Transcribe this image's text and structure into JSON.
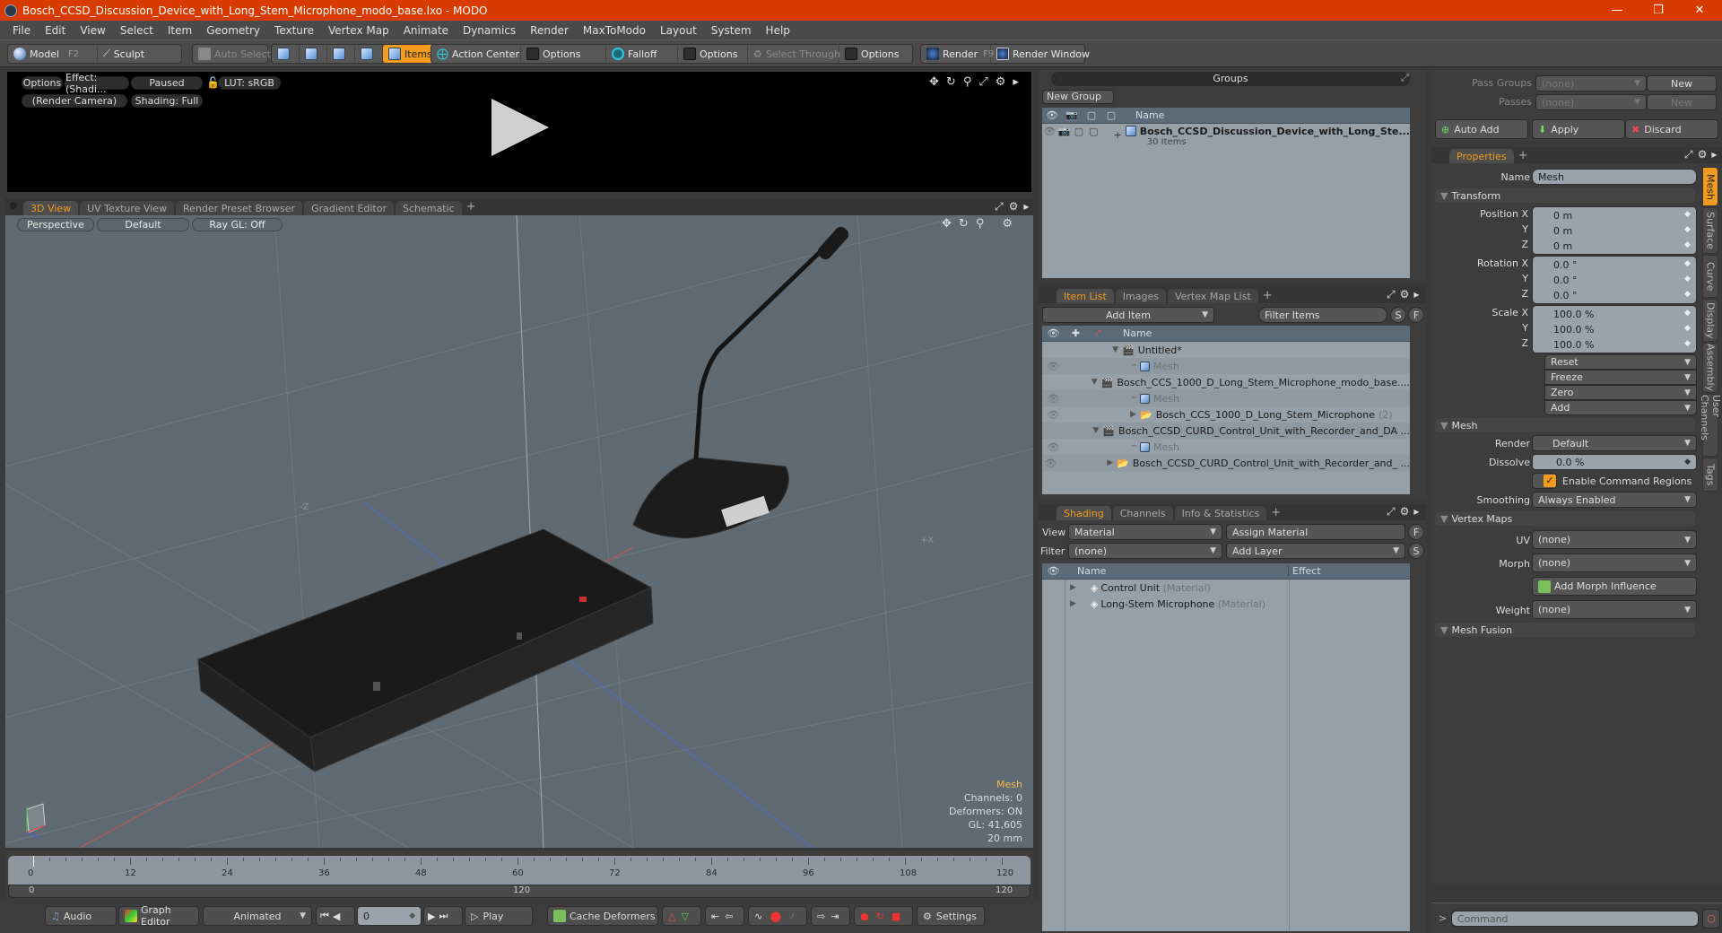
{
  "window": {
    "title": "Bosch_CCSD_Discussion_Device_with_Long_Stem_Microphone_modo_base.lxo - MODO",
    "minimize_icon": "minimize-icon",
    "restore_icon": "restore-icon",
    "close_icon": "close-icon"
  },
  "menu": [
    "File",
    "Edit",
    "View",
    "Select",
    "Item",
    "Geometry",
    "Texture",
    "Vertex Map",
    "Animate",
    "Dynamics",
    "Render",
    "MaxToModo",
    "Layout",
    "System",
    "Help"
  ],
  "toolbar": {
    "model": "Model",
    "model_key": "F2",
    "sculpt": "Sculpt",
    "auto_select": "Auto Select",
    "items": "Items",
    "items_count": "5",
    "action_center": "Action Center",
    "options1": "Options",
    "falloff": "Falloff",
    "options2": "Options",
    "select_through": "Select Through",
    "options3": "Options",
    "render": "Render",
    "render_key": "F9",
    "render_window": "Render Window"
  },
  "render_view": {
    "options": "Options",
    "effect": "Effect: (Shadi...",
    "paused": "Paused",
    "lut": "LUT: sRGB",
    "camera": "(Render Camera)",
    "shading": "Shading: Full"
  },
  "viewport": {
    "tabs": [
      "3D View",
      "UV Texture View",
      "Render Preset Browser",
      "Gradient Editor",
      "Schematic"
    ],
    "active_tab": 0,
    "perspective": "Perspective",
    "default": "Default",
    "raygl": "Ray GL: Off",
    "axis_neg_z": "-Z",
    "axis_pos_x": "+X",
    "info": {
      "selection": "Mesh",
      "channels": "Channels: 0",
      "deformers": "Deformers: ON",
      "gl": "GL: 41,605",
      "unit": "20 mm"
    },
    "accent": "#f2b84b"
  },
  "timeline": {
    "ticks": [
      "0",
      "12",
      "24",
      "36",
      "48",
      "60",
      "72",
      "84",
      "96",
      "108",
      "120"
    ],
    "range_start": "0",
    "range_mid": "120",
    "range_end": "120"
  },
  "transport": {
    "audio": "Audio",
    "graph_editor": "Graph Editor",
    "animated": "Animated",
    "frame": "0",
    "play": "Play",
    "cache_deformers": "Cache Deformers",
    "settings": "Settings"
  },
  "groups": {
    "title": "Groups",
    "new_group": "New Group",
    "col_name": "Name",
    "rows": [
      {
        "name": "Bosch_CCSD_Discussion_Device_with_Long_Ste...",
        "sub": "30 Items"
      }
    ]
  },
  "item_list": {
    "tabs": [
      "Item List",
      "Images",
      "Vertex Map List"
    ],
    "add_item": "Add Item",
    "filter_placeholder": "Filter Items",
    "s_btn": "S",
    "f_btn": "F",
    "col_name": "Name",
    "rows": [
      {
        "label": "Untitled*",
        "type": "scene",
        "indent": 0,
        "eye": false
      },
      {
        "label": "Mesh",
        "type": "mesh",
        "indent": 1,
        "eye": true,
        "dim": true
      },
      {
        "label": "Bosch_CCS_1000_D_Long_Stem_Microphone_modo_base....",
        "type": "scene",
        "indent": 0,
        "eye": false
      },
      {
        "label": "Mesh",
        "type": "mesh",
        "indent": 1,
        "eye": true,
        "dim": true
      },
      {
        "label": "Bosch_CCS_1000_D_Long_Stem_Microphone",
        "count": "(2)",
        "type": "group",
        "indent": 1,
        "eye": true
      },
      {
        "label": "Bosch_CCSD_CURD_Control_Unit_with_Recorder_and_DA ...",
        "type": "scene",
        "indent": 0,
        "eye": false
      },
      {
        "label": "Mesh",
        "type": "mesh",
        "indent": 1,
        "eye": true,
        "dim": true
      },
      {
        "label": "Bosch_CCSD_CURD_Control_Unit_with_Recorder_and_ ...",
        "type": "group",
        "indent": 1,
        "eye": true
      }
    ]
  },
  "shading": {
    "tabs": [
      "Shading",
      "Channels",
      "Info & Statistics"
    ],
    "view_label": "View",
    "view_value": "Material",
    "assign_material": "Assign Material",
    "f_btn": "F",
    "filter_label": "Filter",
    "filter_value": "(none)",
    "add_layer": "Add Layer",
    "s_btn": "S",
    "col_name": "Name",
    "col_effect": "Effect",
    "rows": [
      {
        "name": "Control Unit",
        "kind": "(Material)"
      },
      {
        "name": "Long-Stem Microphone",
        "kind": "(Material)"
      }
    ]
  },
  "pass": {
    "pass_groups_label": "Pass Groups",
    "pass_groups_value": "(none)",
    "new1": "New",
    "passes_label": "Passes",
    "passes_value": "(none)",
    "new2": "New",
    "auto_add": "Auto Add",
    "apply": "Apply",
    "discard": "Discard"
  },
  "properties": {
    "tab": "Properties",
    "name_label": "Name",
    "name_value": "Mesh",
    "transform": "Transform",
    "position": {
      "label": "Position X",
      "x": "0 m",
      "y": "0 m",
      "z": "0 m"
    },
    "rotation": {
      "label": "Rotation X",
      "x": "0.0 °",
      "y": "0.0 °",
      "z": "0.0 °"
    },
    "scale": {
      "label": "Scale X",
      "x": "100.0 %",
      "y": "100.0 %",
      "z": "100.0 %"
    },
    "axis_y": "Y",
    "axis_z": "Z",
    "actions": [
      "Reset",
      "Freeze",
      "Zero",
      "Add"
    ],
    "mesh_section": "Mesh",
    "render_label": "Render",
    "render_value": "Default",
    "dissolve_label": "Dissolve",
    "dissolve_value": "0.0 %",
    "enable_cmd_regions": "Enable Command Regions",
    "enable_cmd_regions_checked": true,
    "smoothing_label": "Smoothing",
    "smoothing_value": "Always Enabled",
    "vertex_maps": "Vertex Maps",
    "uv_label": "UV",
    "uv_value": "(none)",
    "morph_label": "Morph",
    "morph_value": "(none)",
    "add_morph": "Add Morph Influence",
    "weight_label": "Weight",
    "weight_value": "(none)",
    "mesh_fusion": "Mesh Fusion",
    "side_tabs": [
      "Mesh",
      "Surface",
      "Curve",
      "Display",
      "Assembly",
      "User Channels",
      "Tags"
    ]
  },
  "command": {
    "prompt": ">",
    "placeholder": "Command"
  },
  "colors": {
    "accent": "#f29b1d",
    "titlebar": "#d83b01"
  }
}
